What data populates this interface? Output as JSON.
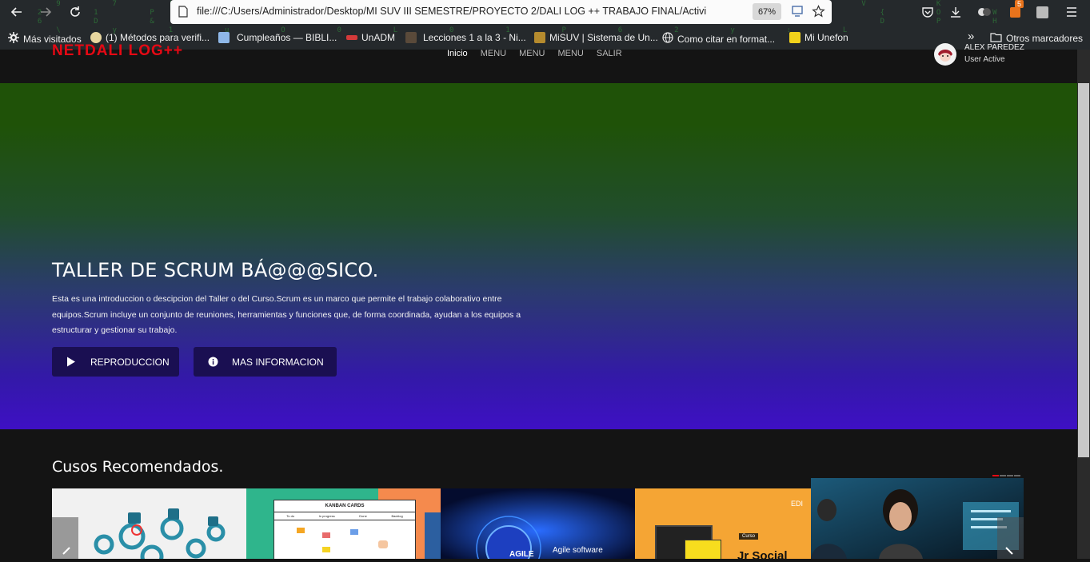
{
  "browser": {
    "url": "file:///C:/Users/Administrador/Desktop/MI SUV III SEMESTRE/PROYECTO 2/DALI LOG ++ TRABAJO FINAL/Activi",
    "zoom": "67%",
    "extension_badge": "5",
    "icons": [
      "back-icon",
      "forward-icon",
      "reload-icon",
      "page-icon",
      "reader-view-icon",
      "bookmark-star-icon",
      "pocket-icon",
      "download-icon",
      "extension-icon",
      "menu-icon"
    ],
    "bookmarks": [
      {
        "label": "Más visitados",
        "icon": "gear-icon"
      },
      {
        "label": "(1) Métodos para verifi...",
        "icon": "site-icon"
      },
      {
        "label": "Cumpleaños — BIBLI...",
        "icon": "site-icon"
      },
      {
        "label": "UnADM",
        "icon": "site-icon"
      },
      {
        "label": "Lecciones 1 a la 3 - Ni...",
        "icon": "site-icon"
      },
      {
        "label": "MiSUV | Sistema de Un...",
        "icon": "site-icon"
      },
      {
        "label": "Como citar en format...",
        "icon": "globe-icon"
      },
      {
        "label": "Mi Unefon",
        "icon": "site-icon"
      }
    ],
    "overflow": "»",
    "other_bookmarks": "Otros marcadores"
  },
  "site": {
    "logo": "NETDALI LOG++",
    "menu": [
      "Inicio",
      "MENU",
      "MENU",
      "MENU",
      "SALIR"
    ],
    "user": {
      "name": "ALEX PAREDEZ",
      "status": "User Active"
    },
    "hero": {
      "title": "TALLER DE SCRUM BÁ@@@SICO.",
      "description": "Esta es una introduccion o descipcion del Taller o del Curso.Scrum es un marco que permite el trabajo colaborativo entre equipos.Scrum incluye un conjunto de reuniones, herramientas y funciones que, de forma coordinada, ayudan a los equipos a estructurar y gestionar su trabajo.",
      "play_label": "REPRODUCCION",
      "info_label": "MAS INFORMACION"
    },
    "section_title": "Cusos Recomendados.",
    "cards": [
      {
        "alt": "gears"
      },
      {
        "alt": "kanban",
        "heading": "KANBAN CARDS",
        "columns": [
          "To do",
          "In progress",
          "Done",
          "Backlog"
        ]
      },
      {
        "alt": "agile",
        "text1": "AGILE",
        "text2": "Agile software"
      },
      {
        "alt": "course",
        "brand": "EDI",
        "tag": "Curso",
        "text": "Jr Social"
      },
      {
        "alt": "developer"
      }
    ],
    "colors": {
      "brand_red": "#e50914",
      "hero_top": "#1f5208",
      "hero_bottom": "#3e10c4",
      "button": "#1a0f52"
    }
  }
}
